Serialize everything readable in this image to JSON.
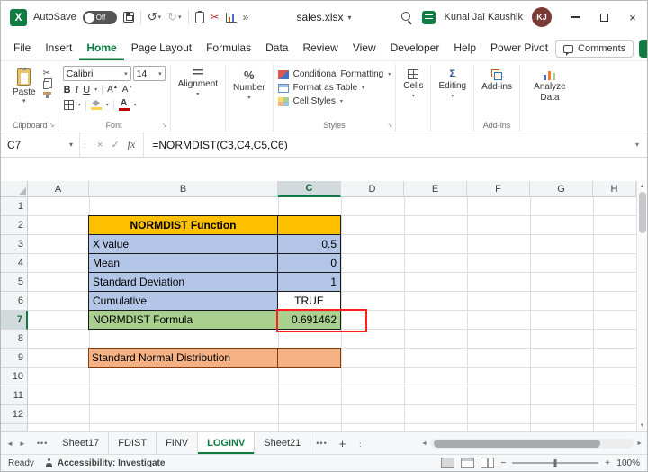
{
  "titlebar": {
    "autosave_label": "AutoSave",
    "autosave_state": "Off",
    "filename": "sales.xlsx",
    "user_name": "Kunal Jai Kaushik",
    "user_initials": "KJ"
  },
  "icons": {
    "excel_logo": "X",
    "undo": "↺",
    "redo": "↻",
    "scissors": "✂",
    "chevron_down": "▾",
    "chevron_more": "»",
    "close": "×",
    "check": "✓",
    "cancel": "×",
    "fx": "fx",
    "percent": "%",
    "sigma": "Σ",
    "dots_h": "•••",
    "dots_v": "⋮",
    "plus": "+",
    "minus": "−",
    "share_arrow": "↗",
    "launcher": "↘",
    "nav_left": "◄",
    "nav_right": "►",
    "scroll_up": "▲",
    "scroll_down": "▼",
    "scroll_left": "◄",
    "scroll_right": "►"
  },
  "ribbon_tabs": {
    "labels": [
      "File",
      "Insert",
      "Home",
      "Page Layout",
      "Formulas",
      "Data",
      "Review",
      "View",
      "Developer",
      "Help",
      "Power Pivot"
    ],
    "active": "Home",
    "comments_label": "Comments"
  },
  "ribbon": {
    "paste": "Paste",
    "font_name": "Calibri",
    "font_size": "14",
    "bold": "B",
    "italic": "I",
    "underline": "U",
    "grow_font": "A",
    "shrink_font": "A",
    "font_color_letter": "A",
    "alignment": "Alignment",
    "number": "Number",
    "conditional_formatting": "Conditional Formatting",
    "format_as_table": "Format as Table",
    "cell_styles": "Cell Styles",
    "cells": "Cells",
    "editing": "Editing",
    "addins": "Add-ins",
    "analyze_data": "Analyze Data",
    "groups": {
      "clipboard": "Clipboard",
      "font": "Font",
      "styles": "Styles",
      "addins": "Add-ins"
    }
  },
  "formula_bar": {
    "name_box": "C7",
    "formula": "=NORMDIST(C3,C4,C5,C6)"
  },
  "grid": {
    "columns": [
      "A",
      "B",
      "C",
      "D",
      "E",
      "F",
      "G",
      "H"
    ],
    "rows": [
      "1",
      "2",
      "3",
      "4",
      "5",
      "6",
      "7",
      "8",
      "9",
      "10",
      "11",
      "12"
    ],
    "selected_cell": "C7",
    "table": {
      "title": "NORMDIST Function",
      "rows": [
        {
          "label": "X value",
          "value": "0.5"
        },
        {
          "label": "Mean",
          "value": "0"
        },
        {
          "label": "Standard Deviation",
          "value": "1"
        },
        {
          "label": "Cumulative",
          "value": "TRUE"
        },
        {
          "label": "NORMDIST Formula",
          "value": "0.691462"
        }
      ],
      "banner": "Standard Normal Distribution"
    }
  },
  "sheet_tabs": {
    "tabs": [
      "Sheet17",
      "FDIST",
      "FINV",
      "LOGINV",
      "Sheet21"
    ],
    "active": "LOGINV"
  },
  "status_bar": {
    "ready": "Ready",
    "accessibility": "Accessibility: Investigate",
    "zoom": "100%"
  },
  "colors": {
    "excel_green": "#107C41",
    "header_orange": "#FFC000",
    "cell_blue": "#B4C6E7",
    "cell_green": "#A9D08E",
    "banner_salmon": "#F4B183",
    "annotation_red": "#FF1F1F"
  }
}
